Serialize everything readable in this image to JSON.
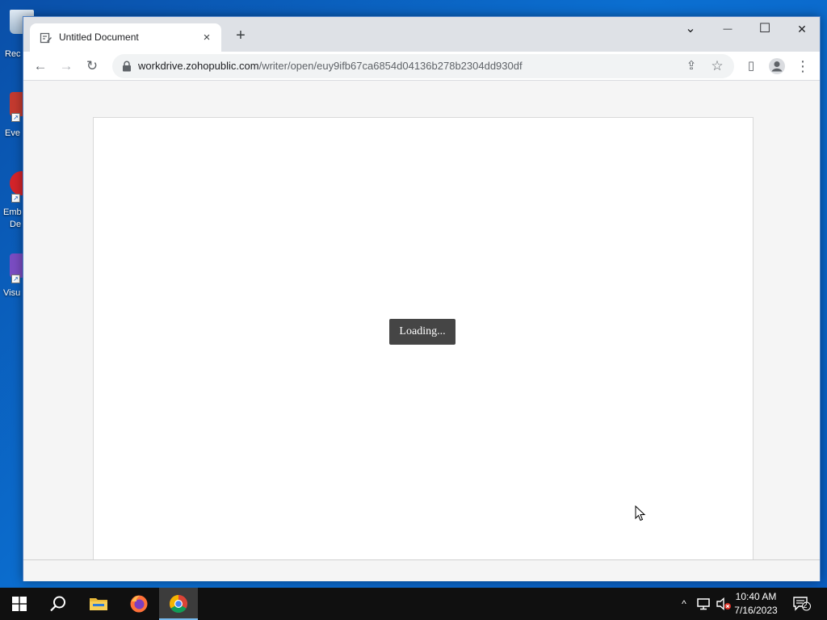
{
  "desktop": {
    "icons": [
      {
        "label": "Rec"
      },
      {
        "label": "Eve"
      },
      {
        "label": "Emb"
      },
      {
        "label": "De"
      },
      {
        "label": "Visu"
      }
    ]
  },
  "browser": {
    "tab": {
      "title": "Untitled Document",
      "close_glyph": "×"
    },
    "new_tab_glyph": "+",
    "window_controls": {
      "tab_search_glyph": "⌄",
      "minimize_glyph": "—",
      "maximize_glyph": "☐",
      "close_glyph": "✕"
    },
    "toolbar": {
      "back_glyph": "←",
      "forward_glyph": "→",
      "reload_glyph": "↻",
      "url_host": "workdrive.zohopublic.com",
      "url_path": "/writer/open/euy9ifb67ca6854d04136b278b2304dd930df",
      "share_glyph": "⇪",
      "bookmark_glyph": "☆",
      "sidepanel_glyph": "▯",
      "menu_glyph": "⋮"
    }
  },
  "page": {
    "loading_text": "Loading..."
  },
  "taskbar": {
    "clock_time": "10:40 AM",
    "clock_date": "7/16/2023",
    "tray_chevron": "^",
    "notification_count": "2"
  }
}
